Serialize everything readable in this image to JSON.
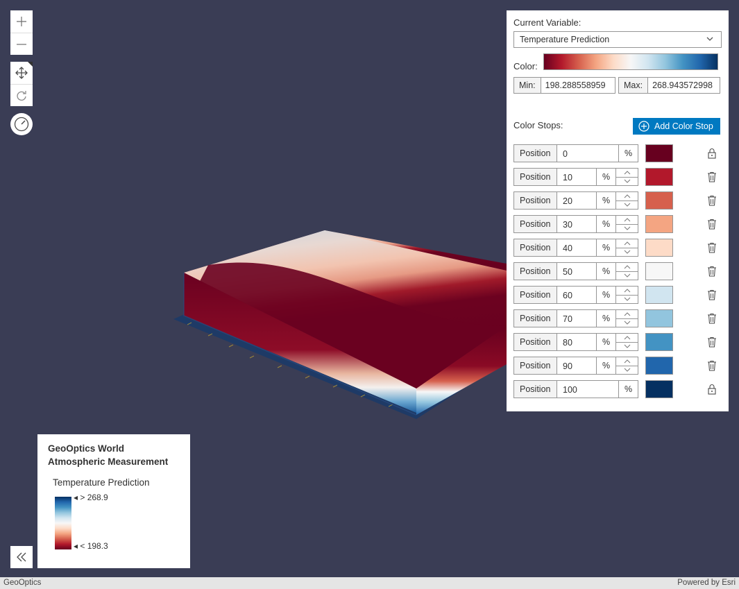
{
  "view": {
    "zoom_in_label": "+",
    "zoom_out_label": "−"
  },
  "panel": {
    "variable_label": "Current Variable:",
    "variable_value": "Temperature Prediction",
    "color_label": "Color:",
    "min_label": "Min:",
    "min_value": "198.288558959",
    "max_label": "Max:",
    "max_value": "268.943572998",
    "color_stops_label": "Color Stops:",
    "add_color_stop_label": "Add Color Stop",
    "position_label": "Position",
    "percent_label": "%",
    "stops": [
      {
        "position": "0",
        "color": "#67001f",
        "locked": true
      },
      {
        "position": "10",
        "color": "#b2182b",
        "locked": false
      },
      {
        "position": "20",
        "color": "#d6604d",
        "locked": false
      },
      {
        "position": "30",
        "color": "#f4a582",
        "locked": false
      },
      {
        "position": "40",
        "color": "#fddbc7",
        "locked": false
      },
      {
        "position": "50",
        "color": "#f7f7f7",
        "locked": false
      },
      {
        "position": "60",
        "color": "#d1e5f0",
        "locked": false
      },
      {
        "position": "70",
        "color": "#92c5de",
        "locked": false
      },
      {
        "position": "80",
        "color": "#4393c3",
        "locked": false
      },
      {
        "position": "90",
        "color": "#2166ac",
        "locked": false
      },
      {
        "position": "100",
        "color": "#053061",
        "locked": true
      }
    ]
  },
  "legend": {
    "title_line1": "GeoOptics World",
    "title_line2": "Atmospheric Measurement",
    "layer_name": "Temperature Prediction",
    "max_label": "> 268.9",
    "min_label": "< 198.3"
  },
  "attribution": {
    "left": "GeoOptics",
    "right": "Powered by Esri"
  },
  "colors": {
    "background": "#3a3d55",
    "accent": "#0079c1"
  }
}
